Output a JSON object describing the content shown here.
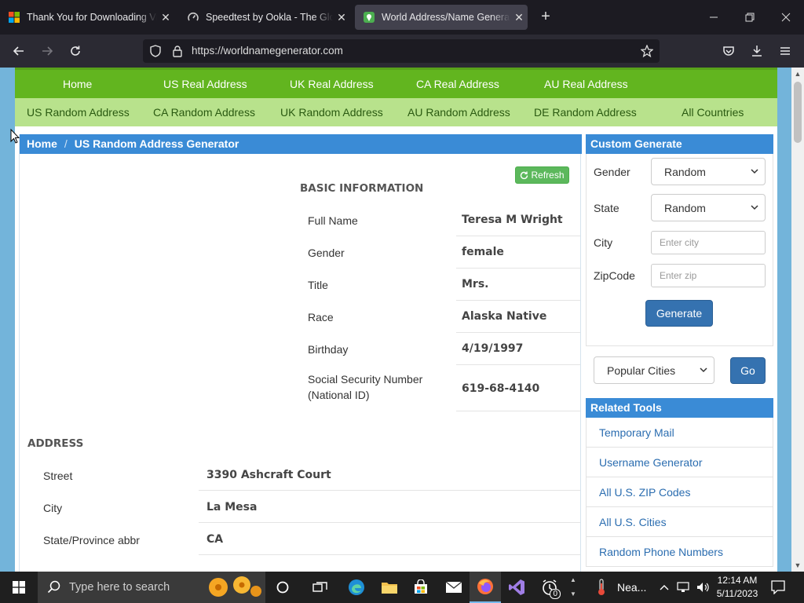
{
  "browser": {
    "tabs": [
      {
        "title": "Thank You for Downloading Visual Studio",
        "active": false
      },
      {
        "title": "Speedtest by Ookla - The Global Broadband Speed Test",
        "active": false
      },
      {
        "title": "World Address/Name Generator",
        "active": true
      }
    ],
    "url": "https://worldnamegenerator.com"
  },
  "site": {
    "menu_primary": [
      "Home",
      "US Real Address",
      "UK Real Address",
      "CA Real Address",
      "AU Real Address"
    ],
    "menu_secondary": [
      "US Random Address",
      "CA Random Address",
      "UK Random Address",
      "AU Random Address",
      "DE Random Address",
      "All Countries"
    ],
    "breadcrumb": {
      "home": "Home",
      "sep": "/",
      "current": "US Random Address Generator"
    },
    "refresh_label": "Refresh",
    "basic_heading": "BASIC INFORMATION",
    "basic_rows": [
      {
        "label": "Full Name",
        "value": "Teresa M Wright"
      },
      {
        "label": "Gender",
        "value": "female"
      },
      {
        "label": "Title",
        "value": "Mrs."
      },
      {
        "label": "Race",
        "value": "Alaska Native"
      },
      {
        "label": "Birthday",
        "value": "4/19/1997"
      },
      {
        "label": "Social Security Number (National ID)",
        "value": "619-68-4140"
      }
    ],
    "address_heading": "ADDRESS",
    "address_rows": [
      {
        "label": "Street",
        "value": "3390 Ashcraft Court"
      },
      {
        "label": "City",
        "value": "La Mesa"
      },
      {
        "label": "State/Province abbr",
        "value": "CA"
      }
    ]
  },
  "sidebar": {
    "custom_heading": "Custom Generate",
    "gender_label": "Gender",
    "gender_value": "Random",
    "state_label": "State",
    "state_value": "Random",
    "city_label": "City",
    "city_placeholder": "Enter city",
    "zip_label": "ZipCode",
    "zip_placeholder": "Enter zip",
    "generate_label": "Generate",
    "popular_value": "Popular Cities",
    "go_label": "Go",
    "tools_heading": "Related Tools",
    "tools": [
      "Temporary Mail",
      "Username Generator",
      "All U.S. ZIP Codes",
      "All U.S. Cities",
      "Random Phone Numbers"
    ]
  },
  "taskbar": {
    "search_placeholder": "Type here to search",
    "weather_text": "Nea...",
    "time": "12:14 AM",
    "date": "5/11/2023",
    "badge": "0"
  }
}
